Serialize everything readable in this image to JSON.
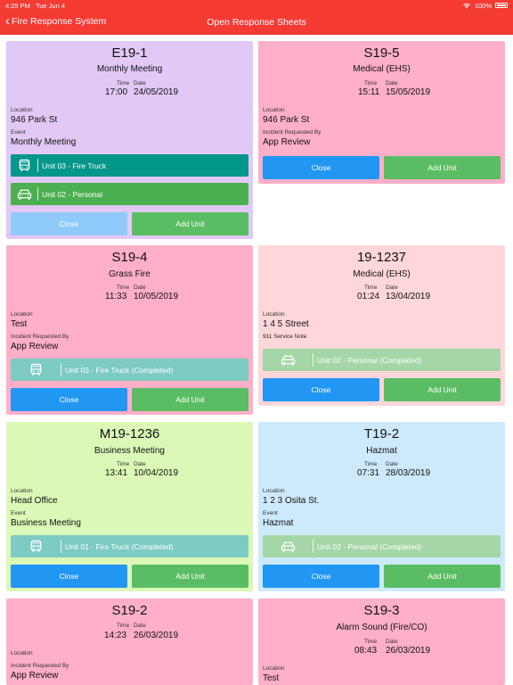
{
  "status_bar": {
    "time": "4:25 PM",
    "date": "Tue Jun 4",
    "battery": "100%"
  },
  "nav": {
    "back_label": "Fire Response System",
    "title": "Open Response Sheets"
  },
  "labels": {
    "time": "Time",
    "date": "Date",
    "location": "Location",
    "event": "Event",
    "incident_requested_by": "Incident Requested By",
    "close": "Close",
    "add_unit": "Add Unit"
  },
  "cards": {
    "e19_1": {
      "code": "E19-1",
      "type": "Monthly Meeting",
      "time": "17:00",
      "date": "24/05/2019",
      "location": "946 Park St",
      "event": "Monthly Meeting",
      "unit1": "Unit 03 - Fire Truck",
      "unit2": "Unit 02 - Personal"
    },
    "s19_5": {
      "code": "S19-5",
      "type": "Medical (EHS)",
      "time": "15:11",
      "date": "15/05/2019",
      "location": "946 Park St",
      "requested_by": "App Review"
    },
    "s19_4": {
      "code": "S19-4",
      "type": "Grass Fire",
      "time": "11:33",
      "date": "10/05/2019",
      "location": "Test",
      "requested_by": "App Review",
      "unit1": "Unit 03 - Fire Truck (Completed)"
    },
    "i19_1237": {
      "code": "19-1237",
      "type": "Medical (EHS)",
      "time": "01:24",
      "date": "13/04/2019",
      "location": "1 4 5 Street",
      "note": "911 Service Note",
      "unit1": "Unit 02 - Personal (Completed)"
    },
    "m19_1236": {
      "code": "M19-1236",
      "type": "Business Meeting",
      "time": "13:41",
      "date": "10/04/2019",
      "location": "Head Office",
      "event": "Business Meeting",
      "unit1": "Unit 01 - Fire Truck (Completed)"
    },
    "t19_2": {
      "code": "T19-2",
      "type": "Hazmat",
      "time": "07:31",
      "date": "28/03/2019",
      "location": "1 2 3 Osita St.",
      "event": "Hazmat",
      "unit1": "Unit 02 - Personal (Completed)"
    },
    "s19_2": {
      "code": "S19-2",
      "time": "14:23",
      "date": "26/03/2019",
      "requested_by": "App Review"
    },
    "s19_3": {
      "code": "S19-3",
      "type": "Alarm Sound (Fire/CO)",
      "time": "08:43",
      "date": "26/03/2019",
      "location": "Test"
    }
  },
  "colors": {
    "header": "#f53b34",
    "purple_card": "#e1c8f5",
    "pink_card": "#ffafc7",
    "light_pink_card": "#ffd6d9",
    "green_card": "#dbf8b6",
    "blue_card": "#cde9fc",
    "close_blue": "#2196f3",
    "add_green": "#5bbd63",
    "fire_truck_teal": "#03968a",
    "personal_green": "#4caf50"
  },
  "icons": [
    "chevron-left-icon",
    "wifi-icon",
    "battery-icon",
    "bus-icon",
    "car-icon"
  ]
}
